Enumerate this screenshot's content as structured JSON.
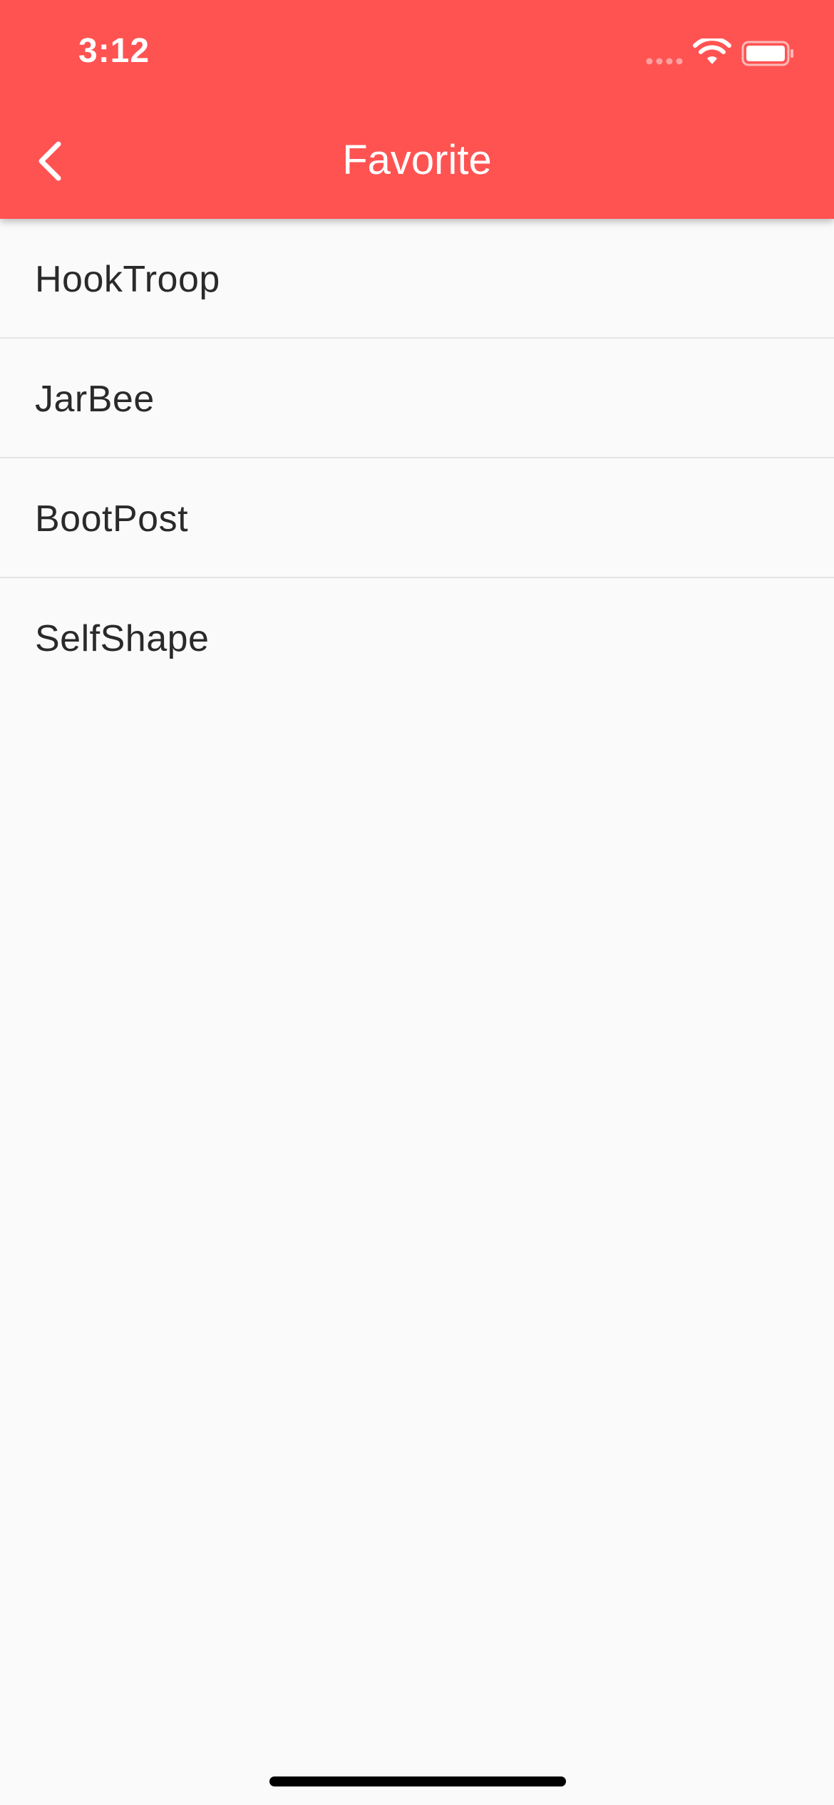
{
  "status_bar": {
    "time": "3:12"
  },
  "app_bar": {
    "title": "Favorite",
    "back_icon": "chevron-left-icon",
    "background_color": "#ff5352"
  },
  "favorites": [
    {
      "label": "HookTroop"
    },
    {
      "label": "JarBee"
    },
    {
      "label": "BootPost"
    },
    {
      "label": "SelfShape"
    }
  ]
}
